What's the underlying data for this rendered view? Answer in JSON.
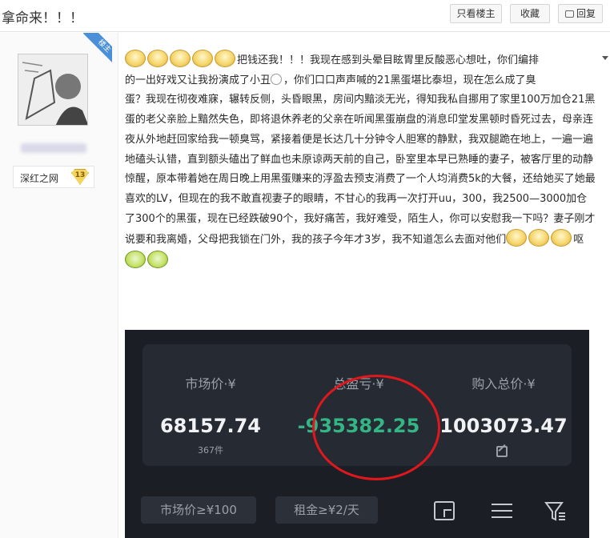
{
  "thread": {
    "title": "拿命来！！！",
    "buttons": {
      "only_op": "只看楼主",
      "favorite": "收藏",
      "reply": "回复"
    }
  },
  "author": {
    "badge": "楼主",
    "group_name": "深红之网",
    "level": "13"
  },
  "post": {
    "line1": "把钱还我！！！我现在感到头晕目眩胃里反酸恶心想吐，你们编排",
    "line2a": "的一出好戏又让我扮演成了小丑",
    "line2b": "，你们口口声声喊的21黑蛋堪比泰坦，现在怎么成了臭",
    "body": "蛋？我现在彻夜难寐，辗转反侧，头昏眼黑，房间内黯淡无光，得知我私自挪用了家里100万加仓21黑蛋的老父亲脸上黯然失色，即将退休养老的父亲在听闻黑蛋崩盘的消息印堂发黑顿时昏死过去，母亲连夜从外地赶回家给我一顿臭骂，紧接着便是长达几十分钟令人胆寒的静默，我双腿跪在地上，一遍一遍地磕头认错，直到额头磕出了鲜血也未原谅两天前的自己，卧室里本早已熟睡的妻子，被客厅里的动静惊醒，原本带着她在周日晚上用黑蛋赚来的浮盈去预支消费了一个人均消费5k的大餐，还给她买了她最喜欢的LV，但现在的我不敢直视妻子的眼睛，不甘心的我再一次打开uu，300，我2500—3000加仓了300个的黑蛋，现在已经跌破90个，我好痛苦，我好难受，陌生人，你可以安慰我一下吗？妻子刚才说要和我离婚，父母把我锁在门外，我的孩子今年才3岁，我不知道怎么去面对他们",
    "end": "呕"
  },
  "app": {
    "market_price_label": "市场价·¥",
    "market_price_value": "68157.74",
    "item_count": "367件",
    "pnl_label": "总盈亏·¥",
    "pnl_value": "-935382.25",
    "cost_label": "购入总价·¥",
    "cost_value": "1003073.47",
    "filter_price": "市场价≥¥100",
    "filter_rent": "租金≥¥2/天"
  },
  "colors": {
    "pnl": "#34b585",
    "highlight_circle": "#e0181e",
    "app_bg": "#1b1e25"
  }
}
